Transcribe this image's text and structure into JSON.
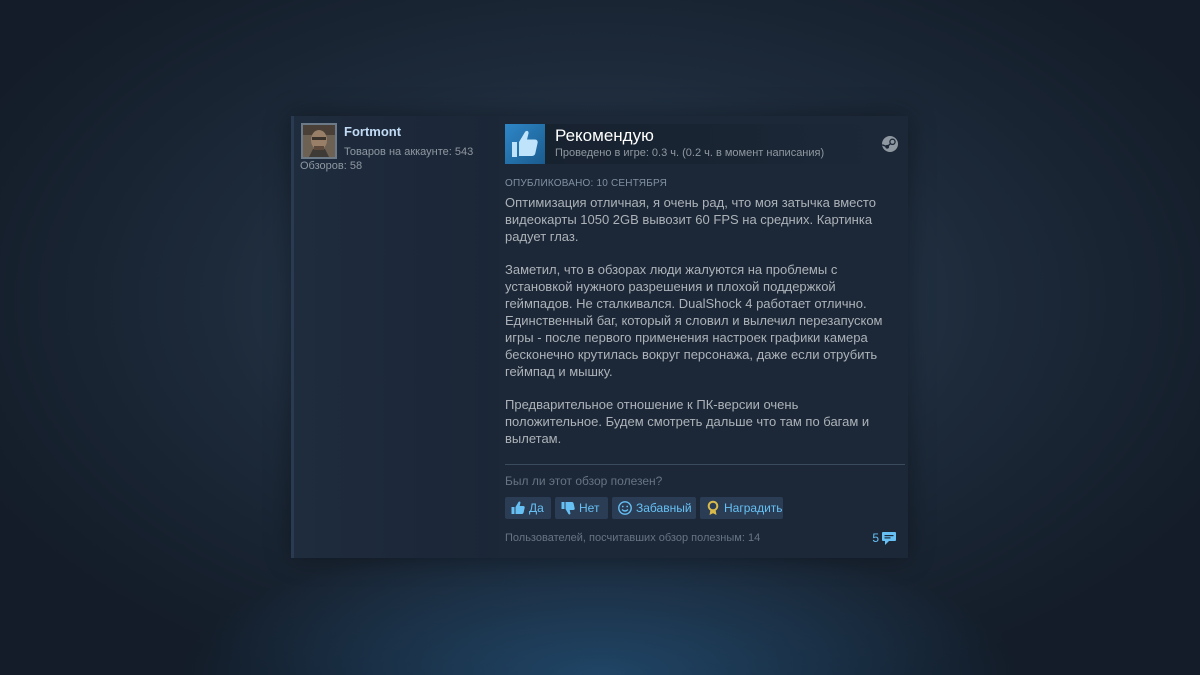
{
  "colors": {
    "accent": "#66c0f4",
    "card_bg": "#1c2838",
    "muted_text": "#8f98a0",
    "body_text": "#acb2b8",
    "award_gold": "#d8b94a"
  },
  "author": {
    "avatar_icon": "user-avatar",
    "name": "Fortmont",
    "products_owned": "Товаров на аккаунте: 543",
    "reviews_count": "Обзоров: 58"
  },
  "review": {
    "verdict_icon": "thumbs-up-icon",
    "verdict": "Рекомендую",
    "hours": "Проведено в игре: 0.3 ч. (0.2 ч. в момент написания)",
    "platform_icon": "steam-icon",
    "posted": "Опубликовано: 10 сентября",
    "paragraphs": [
      "Оптимизация отличная, я очень рад, что моя затычка вместо видеокарты 1050 2GB вывозит 60 FPS на средних. Картинка радует глаз.",
      "Заметил, что в обзорах люди жалуются на проблемы с установкой нужного разрешения и плохой поддержкой геймпадов. Не сталкивался. DualShock 4 работает отлично. Единственный баг, который я словил и вылечил перезапуском игры - после первого применения настроек графики камера бесконечно крутилась вокруг персонажа, даже если отрубить геймпад и мышку.",
      "Предварительное отношение к ПК-версии очень положительное. Будем смотреть дальше что там по багам и вылетам."
    ]
  },
  "feedback": {
    "question": "Был ли этот обзор полезен?",
    "buttons": [
      {
        "label": "Да",
        "icon": "thumbs-up-icon"
      },
      {
        "label": "Нет",
        "icon": "thumbs-down-icon"
      },
      {
        "label": "Забавный",
        "icon": "smiley-icon"
      },
      {
        "label": "Наградить",
        "icon": "award-icon"
      }
    ],
    "helpful_count": "Пользователей, посчитавших обзор полезным: 14",
    "comment_count": "5",
    "comment_icon": "comment-icon"
  }
}
